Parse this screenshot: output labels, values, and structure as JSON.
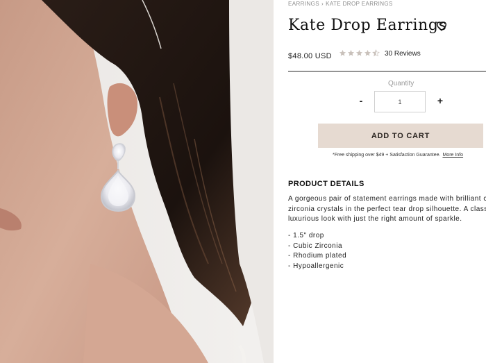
{
  "breadcrumb": {
    "category": "EARRINGS",
    "separator": "›",
    "current": "KATE DROP EARRINGS"
  },
  "product": {
    "title": "Kate Drop Earrings",
    "wishlist_icon": "heart-icon",
    "price": "$48.00 USD",
    "rating": 4.5,
    "rating_max": 5,
    "star_color": "#c9c1bb",
    "reviews_label": "30 Reviews"
  },
  "quantity": {
    "label": "Quantity",
    "minus_label": "-",
    "value": "1",
    "plus_label": "+"
  },
  "cart": {
    "button_label": "ADD TO CART",
    "button_color": "#e6dad1"
  },
  "shipping": {
    "text": "*Free shipping over $49 +  Satisfaction Guarantee.",
    "more_label": "More Info"
  },
  "details": {
    "heading": "PRODUCT DETAILS",
    "description_lines": [
      "A gorgeous pair of statement earrings made with brilliant cu",
      "zirconia crystals in the perfect tear drop silhouette. A classi",
      "luxurious look with just the right amount of sparkle."
    ],
    "features": [
      "- 1.5\" drop",
      "- Cubic Zirconia",
      "- Rhodium plated",
      "- Hypoallergenic"
    ]
  },
  "image": {
    "alt_subject": "model-wearing-earrings"
  }
}
